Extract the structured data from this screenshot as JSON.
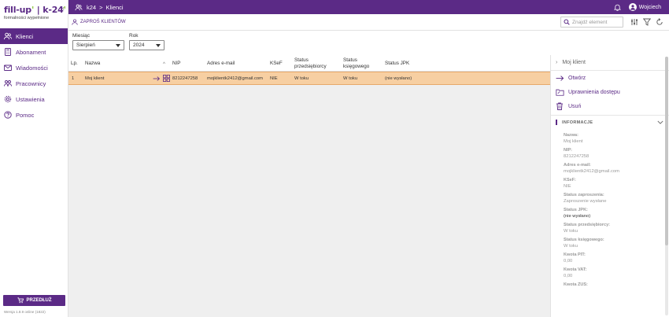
{
  "app": {
    "logo_left": "fill-up",
    "logo_right": "k-24",
    "logo_sep": "|",
    "tagline": "formalności wypełnione"
  },
  "sidebar": {
    "items": [
      {
        "label": "Klienci",
        "icon": "users-icon",
        "active": true
      },
      {
        "label": "Abonament",
        "icon": "calculator-icon"
      },
      {
        "label": "Wiadomości",
        "icon": "mail-icon"
      },
      {
        "label": "Pracownicy",
        "icon": "people-icon"
      },
      {
        "label": "Ustawienia",
        "icon": "gear-icon"
      },
      {
        "label": "Pomoc",
        "icon": "help-icon"
      }
    ],
    "extend_label": "PRZEDŁUŻ",
    "version": "Wersja 1.8.9 online (1822)"
  },
  "topbar": {
    "crumb_root": "k24",
    "crumb_separator": ">",
    "crumb_current": "Klienci",
    "user": "Wojciech"
  },
  "toolbar": {
    "invite_label": "ZAPROŚ KLIENTÓW",
    "search_placeholder": "Znajdź element"
  },
  "filters": {
    "month_label": "Miesiąc",
    "month_value": "Sierpień",
    "year_label": "Rok",
    "year_value": "2024"
  },
  "table": {
    "headers": {
      "lp": "Lp.",
      "name": "Nazwa",
      "sort": "^",
      "nip": "NIP",
      "email": "Adres e-mail",
      "ksef": "KSeF",
      "status_entrepreneur_1": "Status",
      "status_entrepreneur_2": "przedsiębiorcy",
      "status_accountant_1": "Status",
      "status_accountant_2": "księgowego",
      "status_jpk": "Status JPK"
    },
    "rows": [
      {
        "lp": "1",
        "name": "Moj klient",
        "nip": "8212247258",
        "email": "mojklientk2412@gmail.com",
        "ksef": "NIE",
        "status_entrepreneur": "W toku",
        "status_accountant": "W toku",
        "status_jpk": "(nie wysłano)"
      }
    ]
  },
  "panel": {
    "title": "Moj klient",
    "actions": {
      "open": "Otwórz",
      "permissions": "Uprawnienia dostępu",
      "delete": "Usuń"
    },
    "info_title": "INFORMACJE",
    "info": [
      {
        "label": "Nazwa:",
        "value": "Moj klient",
        "dark": false
      },
      {
        "label": "NIP:",
        "value": "8212247258",
        "dark": false
      },
      {
        "label": "Adres e-mail:",
        "value": "mojklientk2412@gmail.com",
        "dark": false
      },
      {
        "label": "KSeF:",
        "value": "NIE",
        "dark": false
      },
      {
        "label": "Status zaproszenia:",
        "value": "Zaproszenie wysłane",
        "dark": false
      },
      {
        "label": "Status JPK:",
        "value": "(nie wysłano)",
        "dark": true
      },
      {
        "label": "Status przedsiębiorcy:",
        "value": "W toku",
        "dark": false
      },
      {
        "label": "Status księgowego:",
        "value": "W toku",
        "dark": false
      },
      {
        "label": "Kwota PIT:",
        "value": "0,00",
        "dark": false
      },
      {
        "label": "Kwota VAT:",
        "value": "0,00",
        "dark": false
      },
      {
        "label": "Kwota ZUS:",
        "value": "",
        "dark": false
      }
    ]
  },
  "colors": {
    "brand": "#5b2a86",
    "accent": "#8dc63f",
    "row_selected": "#f7cfa2"
  }
}
